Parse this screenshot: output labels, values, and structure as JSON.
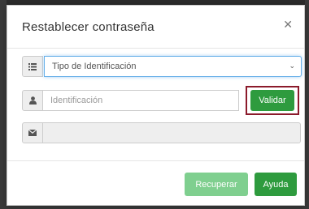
{
  "modal": {
    "title": "Restablecer contraseña",
    "close_icon": "close-icon"
  },
  "form": {
    "id_type": {
      "icon": "list-icon",
      "selected_value": "Tipo de Identificación"
    },
    "id_number": {
      "icon": "user-icon",
      "placeholder": "Identificación",
      "value": "",
      "validate_label": "Validar"
    },
    "email": {
      "icon": "envelope-icon",
      "value": ""
    }
  },
  "footer": {
    "recover_label": "Recuperar",
    "help_label": "Ayuda"
  },
  "colors": {
    "primary_green": "#2e9b3e",
    "disabled_green": "#7fcf8f",
    "highlight_border": "#8b1a2b",
    "focus_blue": "#66afe9"
  }
}
